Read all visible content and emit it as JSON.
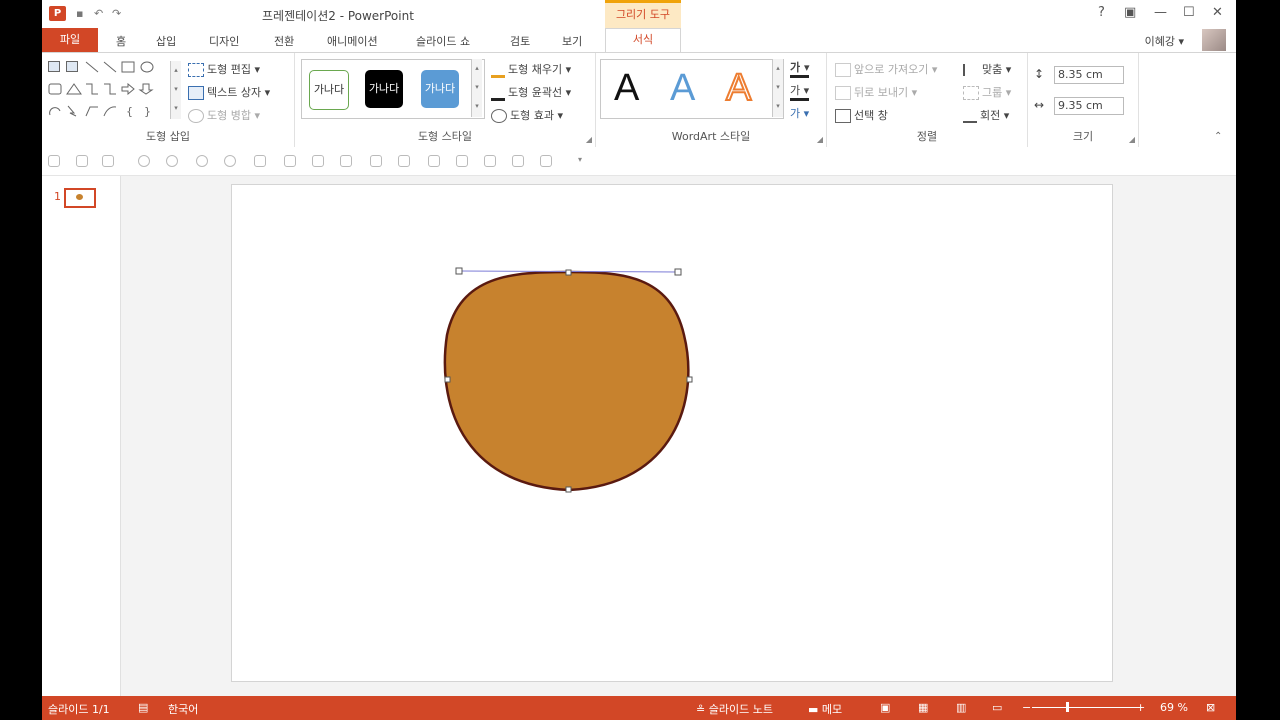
{
  "window": {
    "app_icon": "P",
    "title": "프레젠테이션2 - PowerPoint",
    "context_header": "그리기 도구",
    "help": "?",
    "buttons": [
      "?",
      "▣",
      "—",
      "☐",
      "✕"
    ]
  },
  "tabs": {
    "file": "파일",
    "items": [
      "홈",
      "삽입",
      "디자인",
      "전환",
      "애니메이션",
      "슬라이드 쇼",
      "검토",
      "보기"
    ],
    "active": "서식",
    "user": "이혜강 ▾"
  },
  "ribbon": {
    "shape_insert": {
      "edit_shape": "도형 편집 ▾",
      "text_box": "텍스트 상자 ▾",
      "merge_shapes": "도형 병합 ▾",
      "label": "도형 삽입"
    },
    "shape_styles": {
      "samples": [
        "가나다",
        "가나다",
        "가나다"
      ],
      "fill": "도형 채우기 ▾",
      "outline": "도형 윤곽선 ▾",
      "effects": "도형 효과 ▾",
      "label": "도형 스타일"
    },
    "wordart": {
      "samples": [
        "A",
        "A",
        "A"
      ],
      "label": "WordArt 스타일"
    },
    "arrange": {
      "bring_forward": "앞으로 가져오기 ▾",
      "send_backward": "뒤로 보내기 ▾",
      "selection_pane": "선택 창",
      "align": "맞춤 ▾",
      "group": "그룹 ▾",
      "rotate": "회전 ▾",
      "label": "정렬"
    },
    "size": {
      "height": "8.35 cm",
      "width": "9.35 cm",
      "label": "크기"
    }
  },
  "thumbnail": {
    "number": "1"
  },
  "slide": {
    "shape_fill": "#c7822e",
    "shape_outline": "#5a1a10"
  },
  "status": {
    "slide_count": "슬라이드 1/1",
    "language": "한국어",
    "notes": "슬라이드 노트",
    "comments": "메모",
    "zoom": "69 %",
    "color": "#d24726"
  }
}
